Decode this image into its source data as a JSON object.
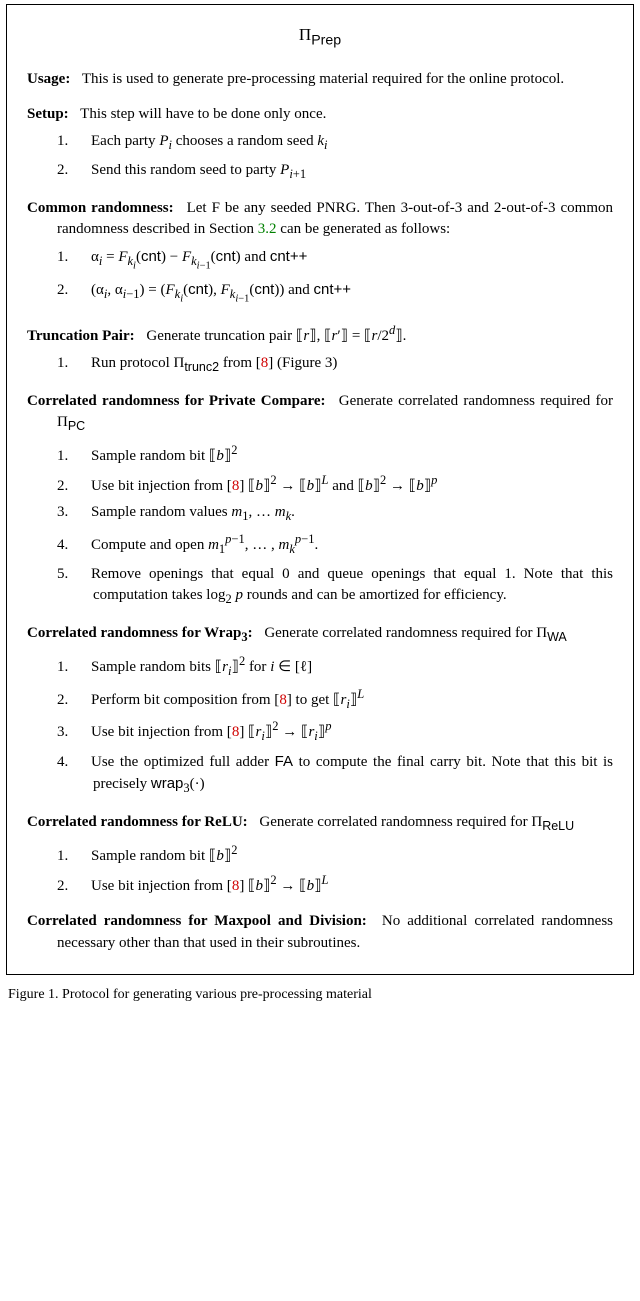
{
  "title": {
    "prefix": "Π",
    "sub": "Prep"
  },
  "usage": {
    "heading": "Usage:",
    "text": "This is used to generate pre-processing material required for the online protocol."
  },
  "setup": {
    "heading": "Setup:",
    "text": "This step will have to be done only once.",
    "items": [
      "Each party Pᵢ chooses a random seed kᵢ",
      "Send this random seed to party Pᵢ₊₁"
    ]
  },
  "common": {
    "heading": "Common randomness:",
    "text_pre": "Let F be any seeded PNRG. Then 3-out-of-3 and 2-out-of-3 common randomness described in Section ",
    "secref": "3.2",
    "text_post": " can be generated as follows:",
    "items": [
      "αᵢ = F_{kᵢ}(cnt) − F_{kᵢ₋₁}(cnt) and cnt++",
      "(αᵢ, αᵢ₋₁) = (F_{kᵢ}(cnt), F_{kᵢ₋₁}(cnt)) and cnt++"
    ]
  },
  "trunc": {
    "heading": "Truncation Pair:",
    "text": "Generate truncation pair ⟦r⟧, ⟦r′⟧ = ⟦r/2ᵈ⟧.",
    "item_pre": "Run protocol Π",
    "item_sub": "trunc2",
    "item_mid": " from [",
    "ref": "8",
    "item_post": "] (Figure 3)"
  },
  "pc": {
    "heading": "Correlated randomness for Private Compare:",
    "text": "Generate correlated randomness required for Π",
    "sub": "PC",
    "items": {
      "i1": "Sample random bit ⟦b⟧²",
      "i2_pre": "Use bit injection from [",
      "ref": "8",
      "i2_post": "] ⟦b⟧² → ⟦b⟧ᴸ and ⟦b⟧² → ⟦b⟧ᵖ",
      "i3": "Sample random values m₁, … mₖ.",
      "i4": "Compute and open m₁^{p−1}, … , mₖ^{p−1}.",
      "i5": "Remove openings that equal 0 and queue openings that equal 1. Note that this computation takes log₂ p rounds and can be amortized for efficiency."
    }
  },
  "wrap": {
    "heading": "Correlated randomness for Wrap₃:",
    "text": "Generate correlated randomness required for Π",
    "sub": "WA",
    "items": {
      "i1": "Sample random bits ⟦rᵢ⟧² for i ∈ [ℓ]",
      "i2_pre": "Perform bit composition from [",
      "ref2": "8",
      "i2_post": "] to get ⟦rᵢ⟧ᴸ",
      "i3_pre": "Use bit injection from [",
      "ref3": "8",
      "i3_post": "] ⟦rᵢ⟧² → ⟦rᵢ⟧ᵖ",
      "i4_pre": "Use the optimized full adder ",
      "i4_fa": "FA",
      "i4_mid": " to compute the final carry bit. Note that this bit is precisely ",
      "i4_wrap": "wrap₃",
      "i4_post": "(·)"
    }
  },
  "relu": {
    "heading": "Correlated randomness for ReLU:",
    "text": "Generate correlated randomness required for Π",
    "sub": "ReLU",
    "items": {
      "i1": "Sample random bit ⟦b⟧²",
      "i2_pre": "Use bit injection from [",
      "ref": "8",
      "i2_post": "] ⟦b⟧² → ⟦b⟧ᴸ"
    }
  },
  "maxpool": {
    "heading": "Correlated randomness for Maxpool and Division:",
    "text": "No additional correlated randomness necessary other than that used in their subroutines."
  },
  "caption": "Figure 1. Protocol for generating various pre-processing material"
}
